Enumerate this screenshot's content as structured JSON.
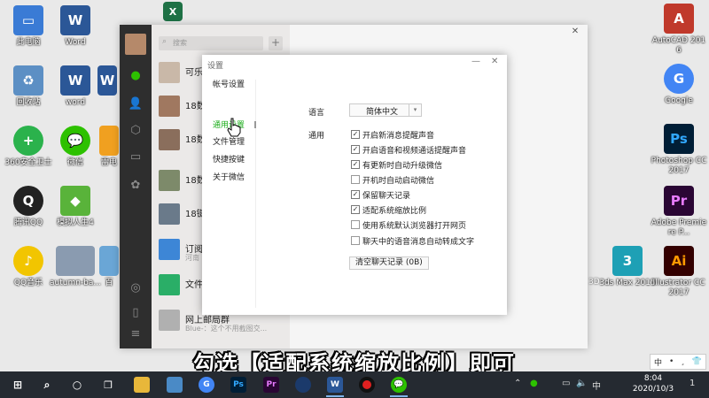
{
  "desktop": {
    "icons_left": [
      {
        "label": "此电脑",
        "icon": "computer-icon",
        "color": "#3a7bd5"
      },
      {
        "label": "回收站",
        "icon": "recycle-bin-icon",
        "color": "#5c8fc4"
      },
      {
        "label": "360安全卫士",
        "icon": "360-security-icon",
        "color": "#2bb24c"
      },
      {
        "label": "腾讯QQ",
        "icon": "qq-icon",
        "color": "#222222"
      },
      {
        "label": "QQ音乐",
        "icon": "qq-music-icon",
        "color": "#f2c500"
      }
    ],
    "icons_col2": [
      {
        "label": "Word",
        "icon": "word-icon",
        "color": "#2b5797"
      },
      {
        "label": "word",
        "icon": "word-icon",
        "color": "#2b5797"
      },
      {
        "label": "微信",
        "icon": "wechat-icon",
        "color": "#2dc100"
      },
      {
        "label": "模拟人生4",
        "icon": "sims-icon",
        "color": "#59b33a"
      },
      {
        "label": "autumn-ba...",
        "icon": "image-file-icon",
        "color": "#8a9bb0"
      }
    ],
    "icons_col3": [
      {
        "label": "",
        "icon": "word-icon",
        "color": "#2b5797"
      },
      {
        "label": "雷电",
        "icon": "emulator-icon",
        "color": "#f0a020"
      },
      {
        "label": "百",
        "icon": "file-icon",
        "color": "#6aa6d6"
      }
    ],
    "icons_right": [
      {
        "label": "AutoCAD 2016",
        "icon": "autocad-icon",
        "color": "#c0392b",
        "text": "A"
      },
      {
        "label": "Google",
        "icon": "chrome-icon",
        "color": "#4285f4",
        "text": "G"
      },
      {
        "label": "Photoshop CC 2017",
        "icon": "photoshop-icon",
        "color": "#001e36",
        "text": "Ps"
      },
      {
        "label": "Adobe Premiere P...",
        "icon": "premiere-icon",
        "color": "#2a0634",
        "text": "Pr"
      },
      {
        "label": "3ds Max 2015",
        "icon": "3dsmax-icon",
        "color": "#1ea0b5",
        "text": "3"
      },
      {
        "label": "Illustrator CC 2017",
        "icon": "illustrator-icon",
        "color": "#330000",
        "text": "Ai"
      }
    ],
    "partial_label": "3D",
    "excel_icon_color": "#1e7145"
  },
  "wechat": {
    "search_placeholder": "搜索",
    "plus": "+",
    "chats": [
      {
        "name": "可乐",
        "sub": "",
        "color": "#c9b8a8"
      },
      {
        "name": "18数",
        "sub": "",
        "color": "#a07860"
      },
      {
        "name": "18数",
        "sub": "",
        "color": "#8a6e5c"
      },
      {
        "name": "18数",
        "sub": "",
        "color": "#7d8a6a"
      },
      {
        "name": "18键",
        "sub": "",
        "color": "#6a7a8a"
      },
      {
        "name": "订阅",
        "sub": "河南",
        "color": "#3d86d6"
      },
      {
        "name": "文件",
        "sub": "",
        "color": "#2aae67"
      },
      {
        "name": "网上",
        "sub": "Blue-：这个不用截图交...",
        "color": "#b0b0b0"
      }
    ],
    "chat_partial": "网上邮局群"
  },
  "settings": {
    "title": "设置",
    "min": "—",
    "close": "✕",
    "nav": [
      "帐号设置",
      "通用设置",
      "文件管理",
      "快捷按键",
      "关于微信"
    ],
    "language_label": "语言",
    "language_value": "简体中文",
    "general_label": "通用",
    "options": [
      {
        "label": "开启新消息提醒声音",
        "checked": true
      },
      {
        "label": "开启语音和视频通话提醒声音",
        "checked": true
      },
      {
        "label": "有更新时自动升级微信",
        "checked": true
      },
      {
        "label": "开机时自动启动微信",
        "checked": false
      },
      {
        "label": "保留聊天记录",
        "checked": true
      },
      {
        "label": "适配系统缩放比例",
        "checked": true
      },
      {
        "label": "使用系统默认浏览器打开网页",
        "checked": false
      },
      {
        "label": "聊天中的语音消息自动转成文字",
        "checked": false
      }
    ],
    "clear_button": "清空聊天记录 (0B)"
  },
  "subtitle": "勾选【适配系统缩放比例】即可",
  "ime": {
    "items": [
      "中",
      "•",
      "¸",
      "👕"
    ]
  },
  "taskbar": {
    "time": "8:04",
    "date": "2020/10/3",
    "ime_mode": "中",
    "notification_count": "1"
  },
  "watermark": "小编 21 0"
}
